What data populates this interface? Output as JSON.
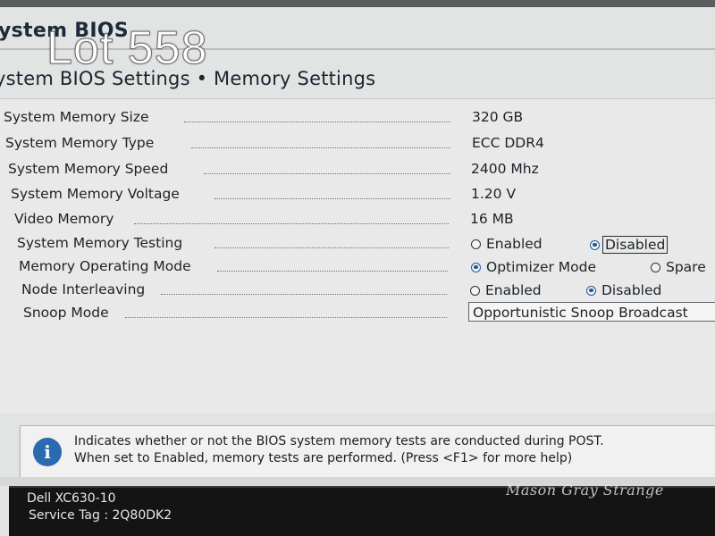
{
  "overlay": {
    "lot_label": "Lot 558",
    "watermark": "Mason Gray Strange"
  },
  "header": {
    "app_title": "ystem BIOS",
    "breadcrumb": "ystem BIOS Settings • Memory Settings"
  },
  "settings": {
    "memory_size": {
      "label": "System Memory Size",
      "value": "320 GB"
    },
    "memory_type": {
      "label": "System Memory Type",
      "value": "ECC DDR4"
    },
    "memory_speed": {
      "label": "System Memory Speed",
      "value": "2400 Mhz"
    },
    "memory_voltage": {
      "label": "System Memory Voltage",
      "value": "1.20 V"
    },
    "video_memory": {
      "label": "Video Memory",
      "value": "16 MB"
    },
    "memory_testing": {
      "label": "System Memory Testing",
      "options": [
        "Enabled",
        "Disabled"
      ],
      "selected": "Disabled"
    },
    "operating_mode": {
      "label": "Memory Operating Mode",
      "options": [
        "Optimizer Mode",
        "Spare"
      ],
      "selected": "Optimizer Mode"
    },
    "node_interleaving": {
      "label": "Node Interleaving",
      "options": [
        "Enabled",
        "Disabled"
      ],
      "selected": "Disabled"
    },
    "snoop_mode": {
      "label": "Snoop Mode",
      "value": "Opportunistic Snoop Broadcast"
    }
  },
  "help": {
    "icon": "info-icon",
    "line1": "Indicates whether or not the BIOS system memory tests are conducted during POST.",
    "line2": "When set to Enabled, memory tests are performed. (Press <F1> for more help)"
  },
  "footer": {
    "model": "Dell XC630-10",
    "service_tag": "Service Tag : 2Q80DK2"
  },
  "colors": {
    "background": "#e2e4e3",
    "accent": "#1e5b9c",
    "info_icon": "#2b6ab0",
    "footer": "#141414"
  }
}
